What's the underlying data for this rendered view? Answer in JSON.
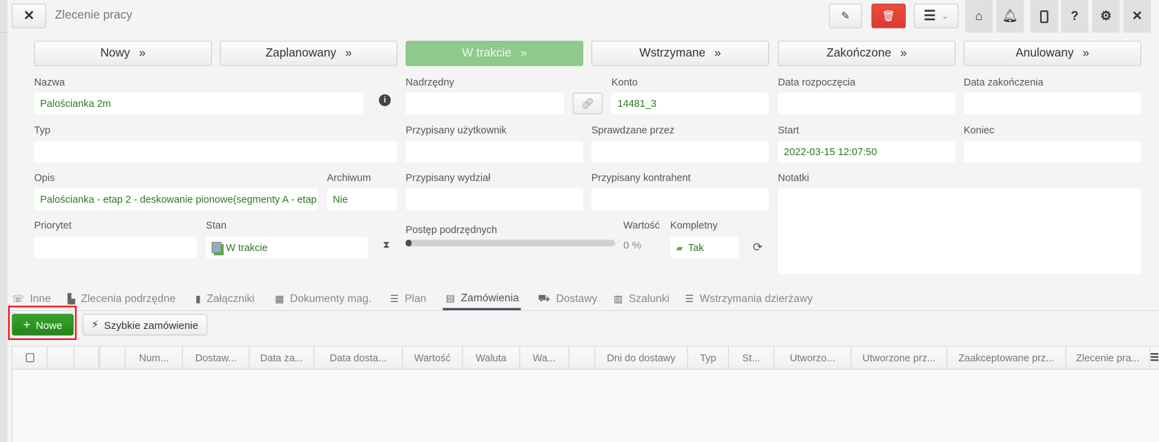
{
  "header": {
    "title": "Zlecenie pracy",
    "close_icon": "close-icon",
    "toolbar": [
      "edit-icon",
      "trash-icon",
      "menu-icon",
      "home-icon",
      "bell-icon",
      "mobile-icon",
      "help-icon",
      "gear-icon",
      "close-icon"
    ],
    "help_glyph": "?"
  },
  "colors": {
    "accent_green": "#2e9a1e",
    "active_status": "#8fc98b",
    "delete_red": "#e04035",
    "value_text": "#2b7a1f",
    "highlight_outline": "#ff0000"
  },
  "statuses": [
    {
      "label": "Nowy",
      "active": false
    },
    {
      "label": "Zaplanowany",
      "active": false
    },
    {
      "label": "W trakcie",
      "active": true
    },
    {
      "label": "Wstrzymane",
      "active": false
    },
    {
      "label": "Zakończone",
      "active": false
    },
    {
      "label": "Anulowany",
      "active": false
    }
  ],
  "chevron": "»",
  "form": {
    "nazwa": {
      "label": "Nazwa",
      "value": "Palościanka 2m"
    },
    "nadrzedny": {
      "label": "Nadrzędny",
      "value": ""
    },
    "konto": {
      "label": "Konto",
      "value": "14481_3"
    },
    "data_rozpoczecia": {
      "label": "Data rozpoczęcia",
      "value": ""
    },
    "data_zakonczenia": {
      "label": "Data zakończenia",
      "value": ""
    },
    "typ": {
      "label": "Typ",
      "value": ""
    },
    "przypisany_uzytkownik": {
      "label": "Przypisany użytkownik",
      "value": ""
    },
    "sprawdzane_przez": {
      "label": "Sprawdzane przez",
      "value": ""
    },
    "start": {
      "label": "Start",
      "value": "2022-03-15 12:07:50"
    },
    "koniec": {
      "label": "Koniec",
      "value": ""
    },
    "opis": {
      "label": "Opis",
      "value": "Palościanka - etap 2 - deskowanie pionowe(segmenty A - etap"
    },
    "archiwum": {
      "label": "Archiwum",
      "value": "Nie"
    },
    "przypisany_wydzial": {
      "label": "Przypisany wydział",
      "value": ""
    },
    "przypisany_kontrahent": {
      "label": "Przypisany kontrahent",
      "value": ""
    },
    "notatki": {
      "label": "Notatki",
      "value": ""
    },
    "priorytet": {
      "label": "Priorytet",
      "value": ""
    },
    "stan": {
      "label": "Stan",
      "value": "W trakcie"
    },
    "postep": {
      "label": "Postęp podrzędnych",
      "percent": 0
    },
    "wartosc": {
      "label": "Wartość",
      "value": "0 %"
    },
    "kompletny": {
      "label": "Kompletny",
      "value": "Tak"
    }
  },
  "tabs": [
    {
      "label": "Inne",
      "icon": "phone-icon"
    },
    {
      "label": "Zlecenia podrzędne",
      "icon": "building-icon"
    },
    {
      "label": "Załączniki",
      "icon": "file-icon"
    },
    {
      "label": "Dokumenty mag.",
      "icon": "grid-icon"
    },
    {
      "label": "Plan",
      "icon": "list-icon"
    },
    {
      "label": "Zamówienia",
      "icon": "table-icon",
      "active": true
    },
    {
      "label": "Dostawy",
      "icon": "truck-icon"
    },
    {
      "label": "Szalunki",
      "icon": "building-icon"
    },
    {
      "label": "Wstrzymania dzierżawy",
      "icon": "list-icon"
    }
  ],
  "actions": {
    "new_label": "Nowe",
    "quick_order_label": "Szybkie zamówienie"
  },
  "table": {
    "columns": [
      "",
      "",
      "",
      "",
      "Num...",
      "Dostaw...",
      "Data za...",
      "Data dosta...",
      "Wartość",
      "Waluta",
      "Wa...",
      "",
      "Dni do dostawy",
      "Typ",
      "St...",
      "Utworzo...",
      "Utworzone prz...",
      "Zaakceptowane prz...",
      "Zlecenie pra..."
    ],
    "rows": []
  }
}
